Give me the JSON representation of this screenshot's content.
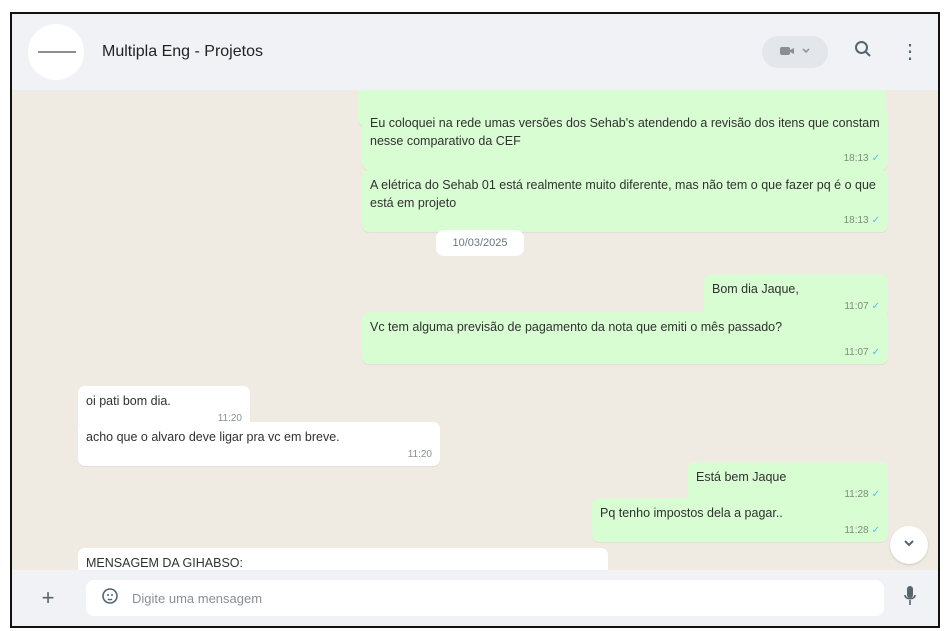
{
  "header": {
    "title": "Multipla Eng - Projetos"
  },
  "messages": [
    {
      "text": "Eu coloquei na rede umas versões dos Sehab's atendendo a revisão dos itens que constam nesse comparativo da CEF",
      "time": "18:13",
      "direction": "out"
    },
    {
      "text": "A elétrica do Sehab 01 está realmente muito diferente, mas não tem o que fazer pq é o que está em projeto",
      "time": "18:13",
      "direction": "out"
    },
    {
      "text": "Bom dia Jaque,",
      "time": "11:07",
      "direction": "out"
    },
    {
      "text": "Vc tem alguma previsão de pagamento da nota que emiti o mês passado?",
      "time": "11:07",
      "direction": "out"
    },
    {
      "text": "oi pati bom dia.",
      "time": "11:20",
      "direction": "in"
    },
    {
      "text": "acho que o alvaro deve ligar pra vc em breve.",
      "time": "11:20",
      "direction": "in"
    },
    {
      "text": "Está bem Jaque",
      "time": "11:28",
      "direction": "out"
    },
    {
      "text": "Pq tenho impostos dela a pagar..",
      "time": "11:28",
      "direction": "out"
    },
    {
      "text": "MENSAGEM DA GIHABSO:",
      "time": "",
      "direction": "in"
    }
  ],
  "date_separator": "10/03/2025",
  "composer": {
    "placeholder": "Digite uma mensagem"
  },
  "icons": {
    "video": "video-icon",
    "search": "search-icon",
    "menu": "more-vertical-icon",
    "plus": "plus-icon",
    "sticker": "sticker-icon",
    "mic": "microphone-icon",
    "scroll": "chevron-down-icon"
  },
  "colors": {
    "outgoing_bubble": "#d9fdd3",
    "incoming_bubble": "#ffffff",
    "chat_background": "#efeae2",
    "header_background": "#f0f2f5"
  }
}
